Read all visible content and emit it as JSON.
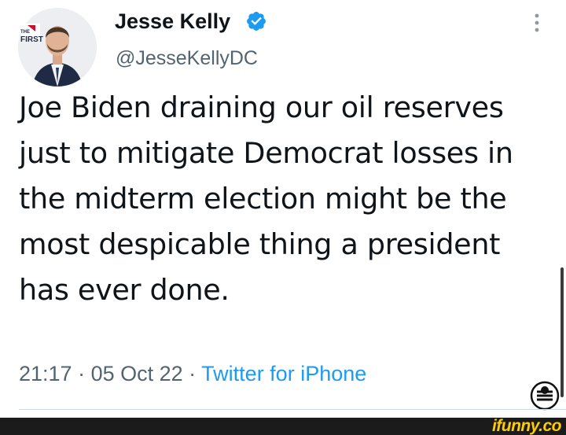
{
  "author": {
    "display_name": "Jesse Kelly",
    "handle": "@JesseKellyDC",
    "verified": true,
    "avatar_badge_line1": "THE",
    "avatar_badge_line2": "FIRST"
  },
  "tweet": {
    "text": "Joe Biden draining our oil reserves just to mitigate Democrat losses in the midterm election might be the most despicable thing a president has ever done.",
    "time": "21:17",
    "separator": " · ",
    "date": "05 Oct 22",
    "source": "Twitter for iPhone"
  },
  "watermark": {
    "text": "ifunny.co"
  },
  "colors": {
    "text": "#0f1419",
    "secondary": "#536471",
    "link": "#1d9bf0",
    "verified": "#1d9bf0",
    "watermark": "#ffcc00"
  },
  "icons": [
    "verified-badge-icon",
    "more-options-icon",
    "ifunny-icon"
  ]
}
